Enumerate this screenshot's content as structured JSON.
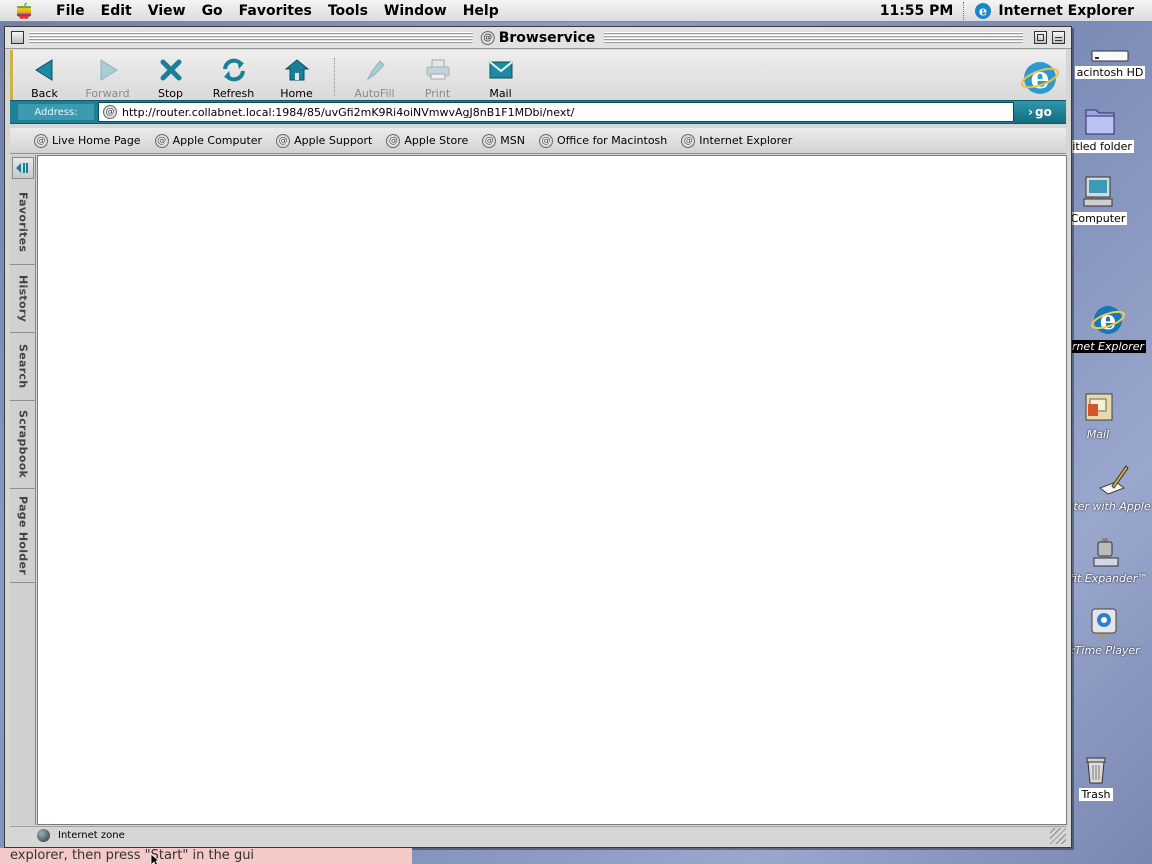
{
  "menubar": {
    "items": [
      "File",
      "Edit",
      "View",
      "Go",
      "Favorites",
      "Tools",
      "Window",
      "Help"
    ],
    "clock": "11:55 PM",
    "active_app": "Internet Explorer"
  },
  "window": {
    "title": "Browservice"
  },
  "toolbar": {
    "buttons": [
      {
        "label": "Back",
        "icon": "back-arrow-icon",
        "enabled": true
      },
      {
        "label": "Forward",
        "icon": "forward-arrow-icon",
        "enabled": false
      },
      {
        "label": "Stop",
        "icon": "stop-x-icon",
        "enabled": true
      },
      {
        "label": "Refresh",
        "icon": "refresh-icon",
        "enabled": true
      },
      {
        "label": "Home",
        "icon": "home-icon",
        "enabled": true
      },
      {
        "label": "AutoFill",
        "icon": "autofill-pen-icon",
        "enabled": false
      },
      {
        "label": "Print",
        "icon": "printer-icon",
        "enabled": false
      },
      {
        "label": "Mail",
        "icon": "mail-envelope-icon",
        "enabled": true
      }
    ]
  },
  "address": {
    "label": "Address:",
    "url": "http://router.collabnet.local:1984/85/uvGfi2mK9Ri4oiNVmwvAgJ8nB1F1MDbi/next/",
    "go_label": "go"
  },
  "favorites": [
    "Live Home Page",
    "Apple Computer",
    "Apple Support",
    "Apple Store",
    "MSN",
    "Office for Macintosh",
    "Internet Explorer"
  ],
  "explorer_tabs": [
    "Favorites",
    "History",
    "Search",
    "Scrapbook",
    "Page Holder"
  ],
  "status": {
    "zone": "Internet zone"
  },
  "desktop": {
    "icons": [
      {
        "label": "acintosh HD",
        "icon": "hard-disk-icon"
      },
      {
        "label": "titled folder",
        "icon": "folder-icon"
      },
      {
        "label": "Computer",
        "icon": "computer-icon"
      },
      {
        "label": "rnet Explorer",
        "icon": "internet-explorer-icon"
      },
      {
        "label": "Mail",
        "icon": "mail-icon"
      },
      {
        "label": "ter with Apple",
        "icon": "register-pen-icon"
      },
      {
        "label": "ffit Expander™",
        "icon": "stuffit-expander-icon"
      },
      {
        "label": "kTime Player",
        "icon": "quicktime-icon"
      },
      {
        "label": "Trash",
        "icon": "trash-icon"
      }
    ]
  },
  "caption": "explorer, then press \"Start\" in the gui"
}
